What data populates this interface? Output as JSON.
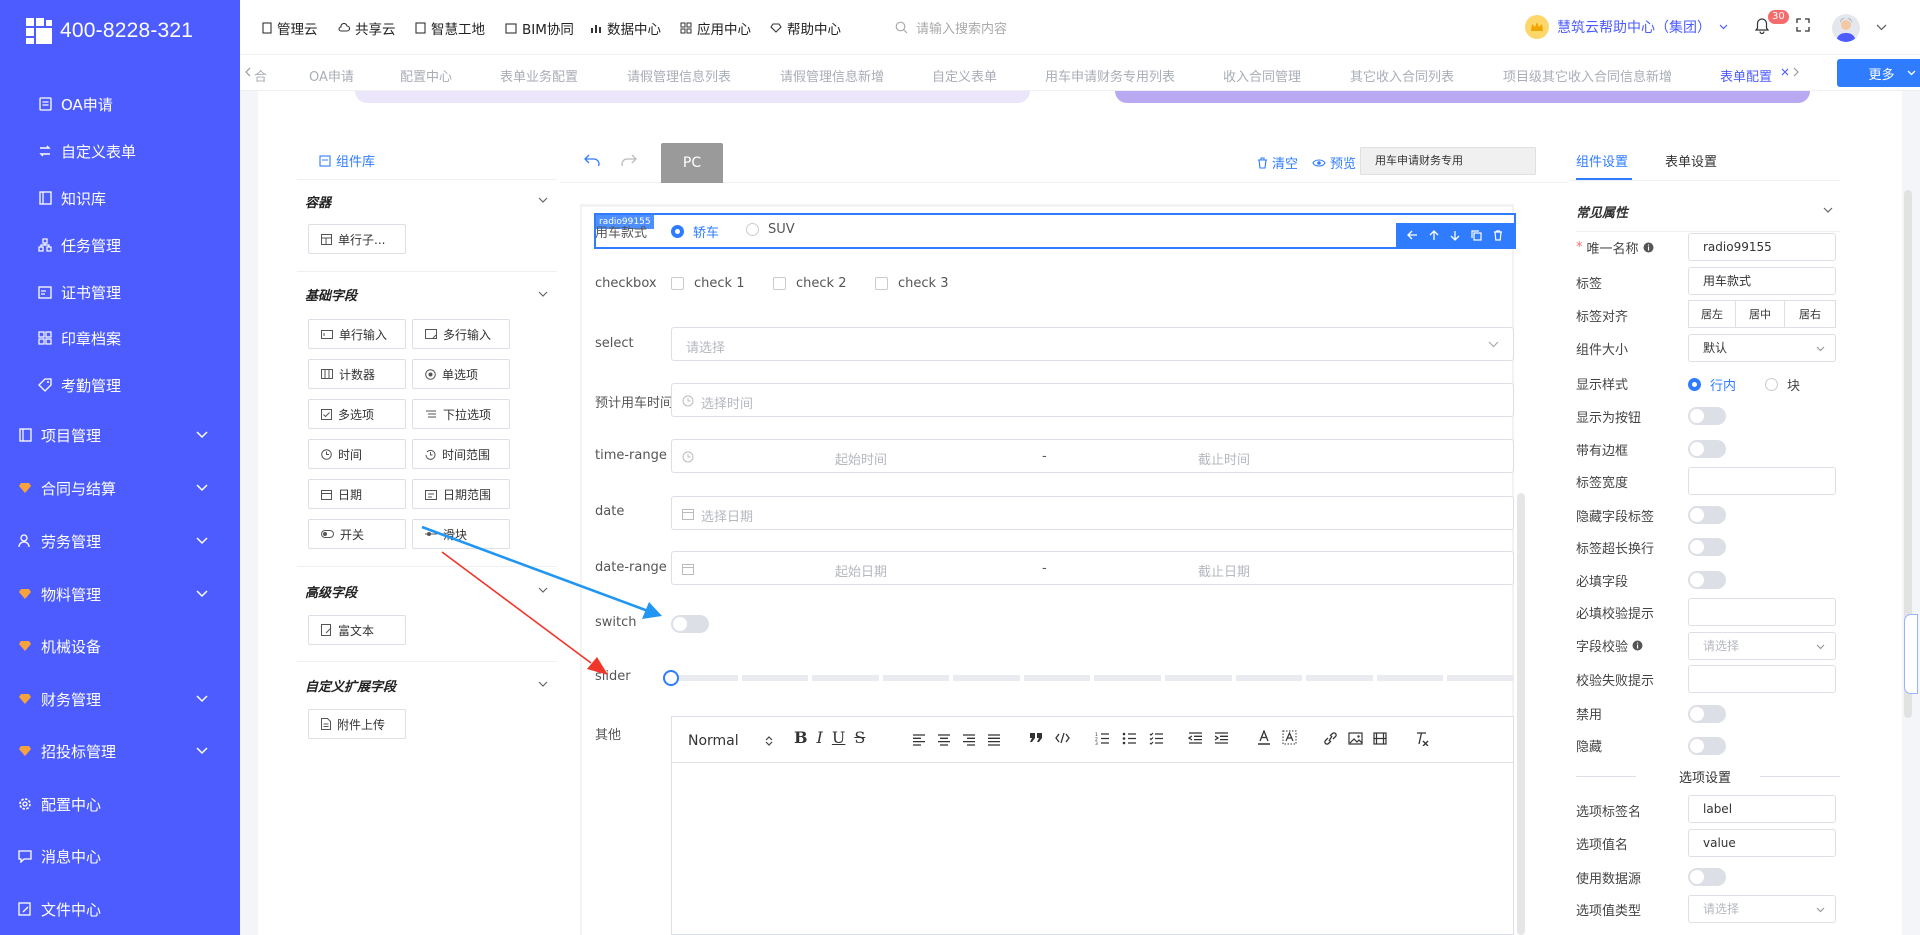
{
  "sidebar": {
    "logo_text": "400-8228-321",
    "items": [
      {
        "label": "OA申请",
        "icon": "document-icon"
      },
      {
        "label": "自定义表单",
        "icon": "swap-icon"
      },
      {
        "label": "知识库",
        "icon": "book-icon"
      },
      {
        "label": "任务管理",
        "icon": "hierarchy-icon"
      },
      {
        "label": "证书管理",
        "icon": "certificate-icon"
      },
      {
        "label": "印章档案",
        "icon": "grid-icon"
      },
      {
        "label": "考勤管理",
        "icon": "tag-icon"
      },
      {
        "label": "项目管理",
        "icon": "book-icon"
      },
      {
        "label": "合同与结算",
        "icon": "diamond-icon"
      },
      {
        "label": "劳务管理",
        "icon": "users-icon"
      },
      {
        "label": "物料管理",
        "icon": "diamond-icon"
      },
      {
        "label": "机械设备",
        "icon": "diamond-icon"
      },
      {
        "label": "财务管理",
        "icon": "diamond-icon"
      },
      {
        "label": "招投标管理",
        "icon": "diamond-icon"
      },
      {
        "label": "配置中心",
        "icon": "gear-icon"
      },
      {
        "label": "消息中心",
        "icon": "message-icon"
      },
      {
        "label": "文件中心",
        "icon": "file-edit-icon"
      }
    ]
  },
  "topnav": {
    "items": [
      "管理云",
      "共享云",
      "智慧工地",
      "BIM协同",
      "数据中心",
      "应用中心",
      "帮助中心"
    ],
    "search_placeholder": "请输入搜索内容",
    "help_center": "慧筑云帮助中心（集团）",
    "notification_count": "30"
  },
  "tabs": {
    "items": [
      "合",
      "OA申请",
      "配置中心",
      "表单业务配置",
      "请假管理信息列表",
      "请假管理信息新增",
      "自定义表单",
      "用车申请财务专用列表",
      "收入合同管理",
      "其它收入合同列表",
      "项目级其它收入合同信息新增",
      "表单配置"
    ],
    "more_label": "更多"
  },
  "component_library": {
    "title": "组件库",
    "sections": [
      {
        "title": "容器",
        "items": [
          "单行子..."
        ]
      },
      {
        "title": "基础字段",
        "items": [
          "单行输入",
          "多行输入",
          "计数器",
          "单选项",
          "多选项",
          "下拉选项",
          "时间",
          "时间范围",
          "日期",
          "日期范围",
          "开关",
          "滑块"
        ]
      },
      {
        "title": "高级字段",
        "items": [
          "富文本"
        ]
      },
      {
        "title": "自定义扩展字段",
        "items": [
          "附件上传"
        ]
      }
    ]
  },
  "canvas": {
    "device_label": "PC",
    "clear_label": "清空",
    "preview_label": "预览",
    "form_name": "用车申请财务专用",
    "selected_tag": "radio99155",
    "fields": {
      "radio_label": "用车款式",
      "radio_options": [
        "轿车",
        "SUV"
      ],
      "checkbox_label": "checkbox",
      "checkbox_options": [
        "check 1",
        "check 2",
        "check 3"
      ],
      "select_label": "select",
      "select_placeholder": "请选择",
      "time_label": "预计用车时间",
      "time_placeholder": "选择时间",
      "timerange_label": "time-range",
      "timerange_start": "起始时间",
      "timerange_end": "截止时间",
      "range_sep": "-",
      "date_label": "date",
      "date_placeholder": "选择日期",
      "daterange_label": "date-range",
      "daterange_start": "起始日期",
      "daterange_end": "截止日期",
      "switch_label": "switch",
      "slider_label": "slider",
      "slider_value": 0,
      "editor_label": "其他",
      "editor_font": "Normal"
    }
  },
  "settings": {
    "tabs": [
      "组件设置",
      "表单设置"
    ],
    "section_title": "常见属性",
    "unique_name_label": "唯一名称",
    "unique_name_value": "radio99155",
    "label_label": "标签",
    "label_value": "用车款式",
    "align_label": "标签对齐",
    "align_options": [
      "居左",
      "居中",
      "居右"
    ],
    "size_label": "组件大小",
    "size_value": "默认",
    "display_style_label": "显示样式",
    "display_style_options": [
      "行内",
      "块"
    ],
    "toggles": [
      "显示为按钮",
      "带有边框"
    ],
    "label_width_label": "标签宽度",
    "toggles2": [
      "隐藏字段标签",
      "标签超长换行",
      "必填字段"
    ],
    "required_hint_label": "必填校验提示",
    "validation_label": "字段校验",
    "validation_placeholder": "请选择",
    "fail_hint_label": "校验失败提示",
    "disabled_label": "禁用",
    "hidden_label": "隐藏",
    "options_section": "选项设置",
    "option_label_name": "选项标签名",
    "option_label_value": "label",
    "option_value_name": "选项值名",
    "option_value_value": "value",
    "use_datasource_label": "使用数据源",
    "option_type_label": "选项值类型",
    "option_type_placeholder": "请选择"
  },
  "colors": {
    "sidebar": "#4d5cff",
    "primary": "#2f7cff",
    "arrow_blue": "#2196f3",
    "arrow_red": "#f0352b"
  }
}
